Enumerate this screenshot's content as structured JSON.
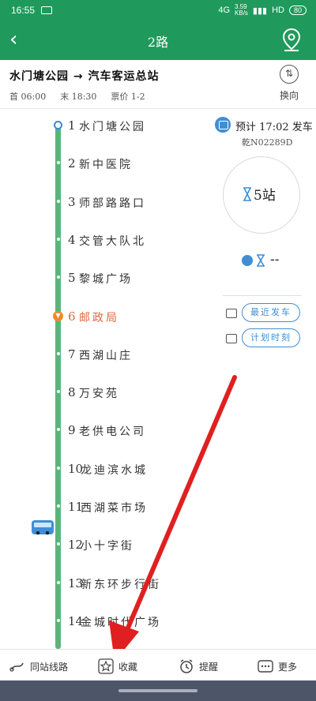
{
  "status_bar": {
    "time": "16:55",
    "network": "4G",
    "speed": "3.59\nKB/s",
    "signal_label": "HD",
    "battery": "80"
  },
  "header": {
    "title": "2路"
  },
  "route": {
    "from": "水门塘公园",
    "to": "汽车客运总站",
    "first_label": "首",
    "first_time": "06:00",
    "last_label": "末",
    "last_time": "18:30",
    "fare_label": "票价",
    "fare": "1-2",
    "swap_label": "换向"
  },
  "stops": [
    {
      "num": "1",
      "name": "水门塘公园"
    },
    {
      "num": "2",
      "name": "新中医院"
    },
    {
      "num": "3",
      "name": "师部路路口"
    },
    {
      "num": "4",
      "name": "交管大队北"
    },
    {
      "num": "5",
      "name": "黎城广场"
    },
    {
      "num": "6",
      "name": "邮政局"
    },
    {
      "num": "7",
      "name": "西湖山庄"
    },
    {
      "num": "8",
      "name": "万安苑"
    },
    {
      "num": "9",
      "name": "老供电公司"
    },
    {
      "num": "10",
      "name": "龙迪滨水城"
    },
    {
      "num": "11",
      "name": "西湖菜市场"
    },
    {
      "num": "12",
      "name": "小十字街"
    },
    {
      "num": "13",
      "name": "新东环步行街"
    },
    {
      "num": "14",
      "name": "金城时代广场"
    }
  ],
  "current_stop_marker": "▼",
  "panel": {
    "plan_label": "预计",
    "plan_time": "17:02",
    "plan_suffix": "发车",
    "plate": "乾N02289D",
    "stations_count": "5站",
    "realtime_placeholder": "--",
    "recent_departure": "最近发车",
    "planned_schedule": "计划时刻"
  },
  "tabs": [
    {
      "label": "同站线路",
      "icon": "route-icon"
    },
    {
      "label": "收藏",
      "icon": "star-icon"
    },
    {
      "label": "提醒",
      "icon": "alarm-icon"
    },
    {
      "label": "更多",
      "icon": "more-icon"
    }
  ],
  "colors": {
    "primary_green": "#1f9a5c",
    "line_green": "#5ab57b",
    "accent_blue": "#3f8ed6",
    "current_orange": "#e0683a",
    "arrow_red": "#e02020"
  }
}
